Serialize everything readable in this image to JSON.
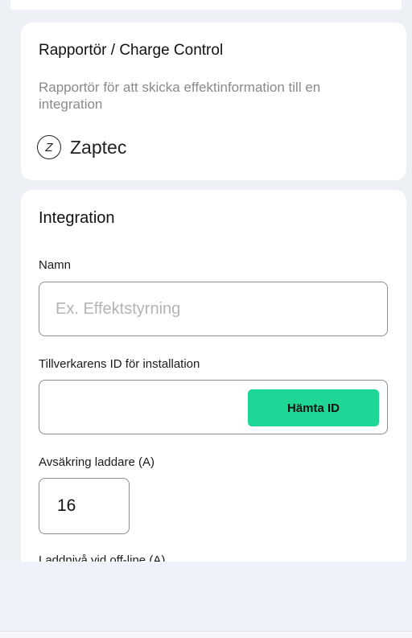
{
  "reporter_card": {
    "title": "Rapportör / Charge Control",
    "description": "Rapportör för att skicka effektinformation till en integration",
    "brand": {
      "icon": "zaptec-logo-icon",
      "icon_glyph": "Z",
      "name": "Zaptec"
    }
  },
  "integration_card": {
    "title": "Integration",
    "name_field": {
      "label": "Namn",
      "value": "",
      "placeholder": "Ex. Effektstyrning"
    },
    "id_field": {
      "label": "Tillverkarens ID för installation",
      "value": "",
      "button_label": "Hämta ID"
    },
    "fuse_field": {
      "label": "Avsäkring laddare (A)",
      "value": "16"
    },
    "offline_field": {
      "label": "Laddnivå vid off-line (A)"
    }
  },
  "colors": {
    "accent": "#1ed696",
    "background": "#edf0f5",
    "card": "#ffffff",
    "muted_text": "#8a8a8a"
  }
}
